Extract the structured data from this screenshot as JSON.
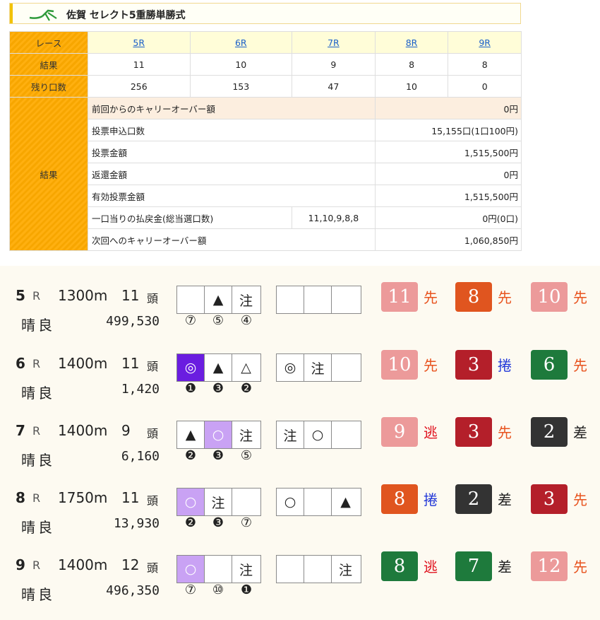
{
  "header": {
    "title": "佐賀 セレクト5重勝単勝式"
  },
  "result_table": {
    "race_label": "レース",
    "races": [
      "5R",
      "6R",
      "7R",
      "8R",
      "9R"
    ],
    "result_label": "結果",
    "results": [
      "11",
      "10",
      "9",
      "8",
      "8"
    ],
    "remaining_label": "残り口数",
    "remaining": [
      "256",
      "153",
      "47",
      "10",
      "0"
    ],
    "summary_label": "結果",
    "summary": [
      {
        "key": "前回からのキャリーオーバー額",
        "value": "0円"
      },
      {
        "key": "投票申込口数",
        "value": "15,155口(1口100円)"
      },
      {
        "key": "投票金額",
        "value": "1,515,500円"
      },
      {
        "key": "返還金額",
        "value": "0円"
      },
      {
        "key": "有効投票金額",
        "value": "1,515,500円"
      },
      {
        "key": "一口当りの払戻金(総当選口数)",
        "combo": "11,10,9,8,8",
        "value": "0円(0口)"
      },
      {
        "key": "次回へのキャリーオーバー額",
        "value": "1,060,850円"
      }
    ]
  },
  "races": [
    {
      "no": "5",
      "r": "R",
      "dist": "1300m",
      "heads": "11",
      "heads_unit": "頭",
      "weather": "晴良",
      "sales": "499,530",
      "marks1": [
        "",
        "▲",
        "注"
      ],
      "marks2": [
        "",
        "",
        ""
      ],
      "picks": [
        "⑦",
        "⑤",
        "④"
      ],
      "places": [
        {
          "num": "11",
          "style": "先",
          "color": "#ec9a9a",
          "style_color": "#e8531e"
        },
        {
          "num": "8",
          "style": "先",
          "color": "#e0551f",
          "style_color": "#e8531e"
        },
        {
          "num": "10",
          "style": "先",
          "color": "#ec9a9a",
          "style_color": "#e8531e"
        }
      ]
    },
    {
      "no": "6",
      "r": "R",
      "dist": "1400m",
      "heads": "11",
      "heads_unit": "頭",
      "weather": "晴良",
      "sales": "1,420",
      "marks1": [
        "◎",
        "▲",
        "△"
      ],
      "marks2": [
        "◎",
        "注",
        ""
      ],
      "picks": [
        "❶",
        "❸",
        "❷"
      ],
      "places": [
        {
          "num": "10",
          "style": "先",
          "color": "#ec9a9a",
          "style_color": "#e8531e"
        },
        {
          "num": "3",
          "style": "捲",
          "color": "#b41f2a",
          "style_color": "#1f35d8"
        },
        {
          "num": "6",
          "style": "先",
          "color": "#1e7a3c",
          "style_color": "#e8531e"
        }
      ]
    },
    {
      "no": "7",
      "r": "R",
      "dist": "1400m",
      "heads": "9",
      "heads_unit": "頭",
      "weather": "晴良",
      "sales": "6,160",
      "marks1": [
        "▲",
        "○",
        "注"
      ],
      "marks2": [
        "注",
        "○",
        ""
      ],
      "picks": [
        "❷",
        "❸",
        "⑤"
      ],
      "places": [
        {
          "num": "9",
          "style": "逃",
          "color": "#ec9a9a",
          "style_color": "#e0121e"
        },
        {
          "num": "3",
          "style": "先",
          "color": "#b41f2a",
          "style_color": "#e8531e"
        },
        {
          "num": "2",
          "style": "差",
          "color": "#333333",
          "style_color": "#222222"
        }
      ]
    },
    {
      "no": "8",
      "r": "R",
      "dist": "1750m",
      "heads": "11",
      "heads_unit": "頭",
      "weather": "晴良",
      "sales": "13,930",
      "marks1": [
        "○",
        "注",
        ""
      ],
      "marks2": [
        "○",
        "",
        "▲"
      ],
      "picks": [
        "❷",
        "❸",
        "⑦"
      ],
      "places": [
        {
          "num": "8",
          "style": "捲",
          "color": "#e0551f",
          "style_color": "#1f35d8"
        },
        {
          "num": "2",
          "style": "差",
          "color": "#333333",
          "style_color": "#222222"
        },
        {
          "num": "3",
          "style": "先",
          "color": "#b41f2a",
          "style_color": "#e8531e"
        }
      ]
    },
    {
      "no": "9",
      "r": "R",
      "dist": "1400m",
      "heads": "12",
      "heads_unit": "頭",
      "weather": "晴良",
      "sales": "496,350",
      "marks1": [
        "○",
        "",
        "注"
      ],
      "marks2": [
        "",
        "",
        "注"
      ],
      "picks": [
        "⑦",
        "⑩",
        "❶"
      ],
      "places": [
        {
          "num": "8",
          "style": "逃",
          "color": "#1e7a3c",
          "style_color": "#e0121e"
        },
        {
          "num": "7",
          "style": "差",
          "color": "#1e7a3c",
          "style_color": "#222222"
        },
        {
          "num": "12",
          "style": "先",
          "color": "#ec9a9a",
          "style_color": "#e8531e"
        }
      ]
    }
  ],
  "mark_colors": {
    "purple": "#6a1de0",
    "lavender": "#c9a2f4"
  }
}
